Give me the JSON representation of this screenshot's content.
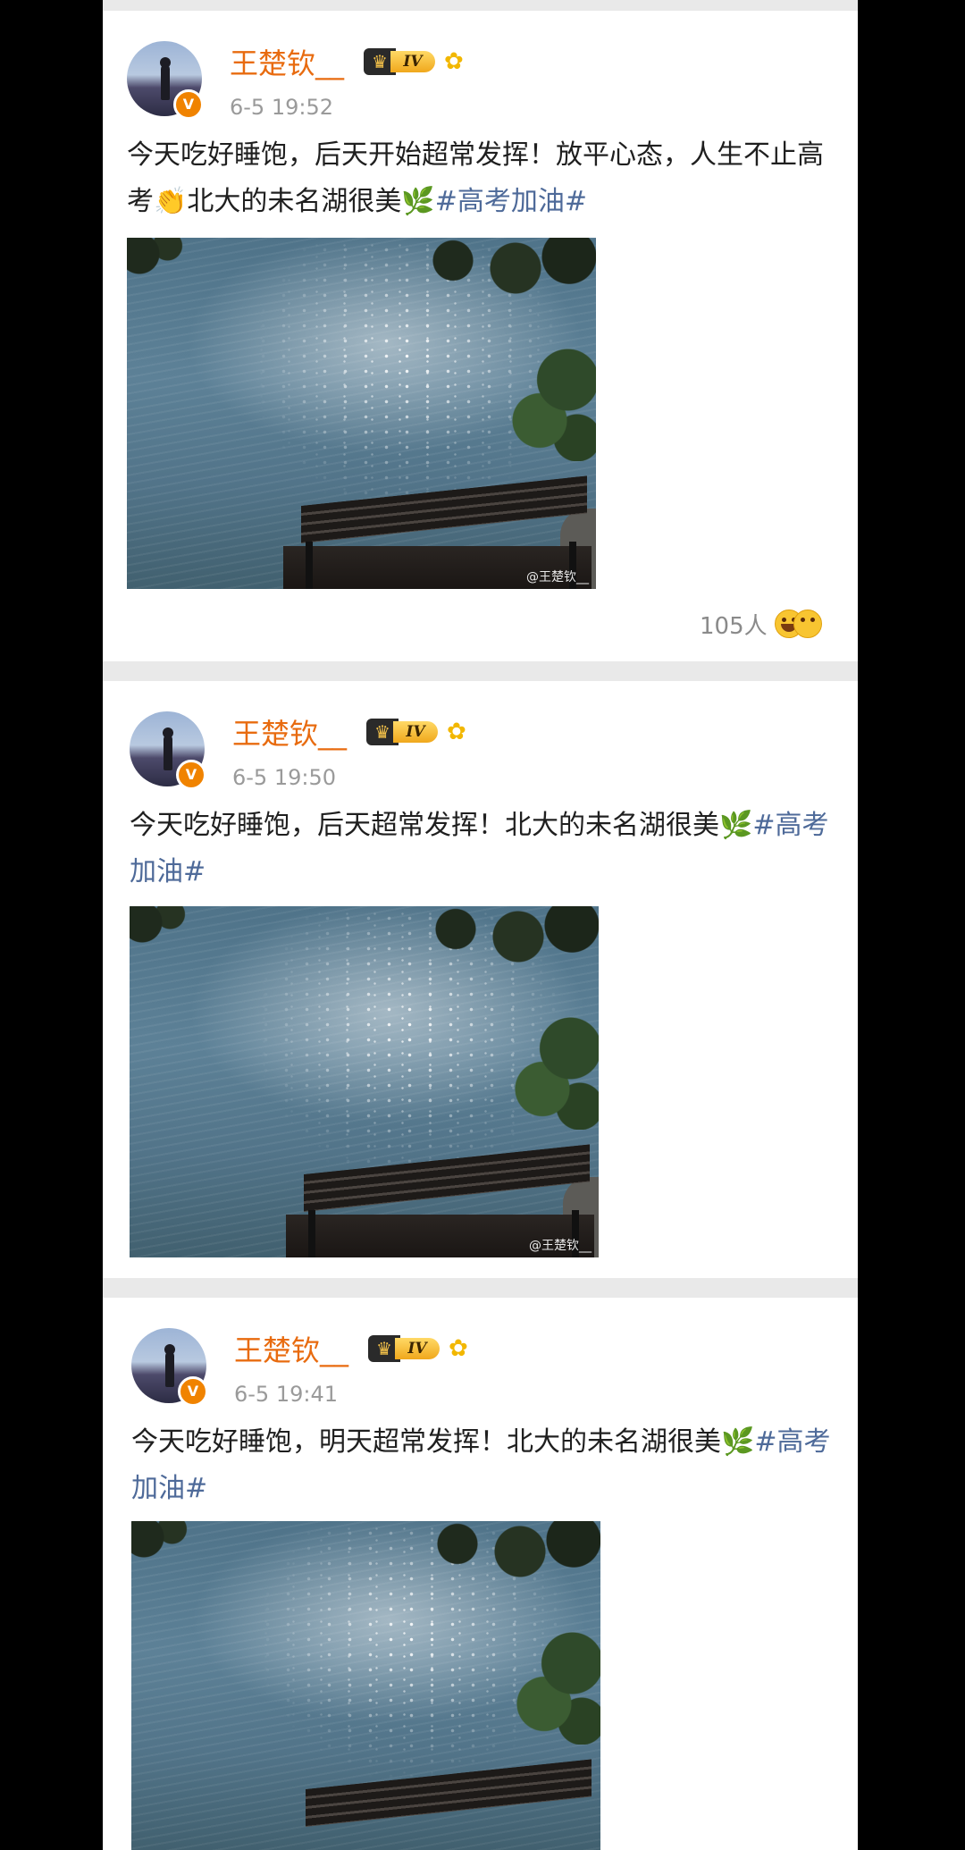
{
  "posts": [
    {
      "username": "王楚钦__",
      "level_badge": "IV",
      "timestamp": "6-5 19:52",
      "verified_mark": "V",
      "text": "今天吃好睡饱，后天开始超常发挥！放平心态，人生不止高考",
      "clap_emoji": "👏",
      "text_tail": "北大的未名湖很美",
      "leaf_emoji": "🌿",
      "hashtag": "#高考加油#",
      "watermark": "@王楚钦__",
      "reaction_count": "105人"
    },
    {
      "username": "王楚钦__",
      "level_badge": "IV",
      "timestamp": "6-5 19:50",
      "verified_mark": "V",
      "text": "今天吃好睡饱，后天超常发挥！北大的未名湖很美",
      "leaf_emoji": "🌿",
      "hashtag": "#高考加油#",
      "watermark": "@王楚钦__"
    },
    {
      "username": "王楚钦__",
      "level_badge": "IV",
      "timestamp": "6-5 19:41",
      "verified_mark": "V",
      "text": "今天吃好睡饱，明天超常发挥！北大的未名湖很美",
      "leaf_emoji": "🌿",
      "hashtag": "#高考加油#"
    }
  ],
  "icons": {
    "crown": "crown-icon",
    "flower": "sunflower-icon",
    "verified": "verified-badge-icon"
  },
  "colors": {
    "username": "#e86b0f",
    "hashtag": "#4e6a99",
    "timestamp": "#9a9a9a",
    "verified": "#f08300"
  }
}
